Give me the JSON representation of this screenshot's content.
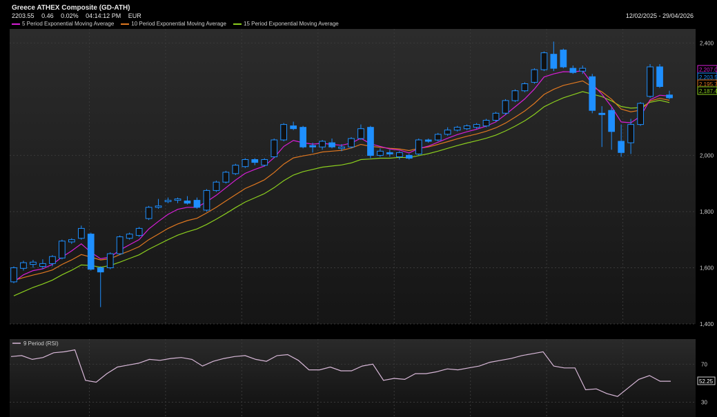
{
  "header": {
    "title": "Greece ATHEX Composite (GD-ATH)",
    "last": "2203.55",
    "change": "0.46",
    "change_pct": "0.02%",
    "time": "04:14:12 PM",
    "currency": "EUR",
    "date_range": "12/02/2025 - 29/04/2026"
  },
  "colors": {
    "background": "#000000",
    "panel_top": "#2a2a2a",
    "panel_bottom": "#141414",
    "grid": "#3a3a3a",
    "candle": "#1e8fff",
    "ema5": "#d81ed8",
    "ema10": "#e07820",
    "ema15": "#8ccf1e",
    "rsi": "#d8b8d8"
  },
  "chart_data": [
    {
      "type": "candlestick",
      "title": "Greece ATHEX Composite (GD-ATH)",
      "ylim": [
        1400,
        2450
      ],
      "y_ticks": [
        "1,400",
        "1,600",
        "1,800",
        "2,000",
        "2,400"
      ],
      "y_tick_values": [
        1400,
        1600,
        1800,
        2000,
        2400
      ],
      "legend_position": "top-left",
      "grid": true,
      "series": [
        {
          "name": "5 Period Exponential Moving Average",
          "color": "#d81ed8"
        },
        {
          "name": "10 Period Exponential Moving Average",
          "color": "#e07820"
        },
        {
          "name": "15 Period Exponential Moving Average",
          "color": "#8ccf1e"
        }
      ],
      "candles": [
        [
          1550,
          1605,
          1545,
          1600
        ],
        [
          1598,
          1625,
          1590,
          1618
        ],
        [
          1612,
          1628,
          1600,
          1620
        ],
        [
          1605,
          1630,
          1595,
          1615
        ],
        [
          1615,
          1645,
          1605,
          1640
        ],
        [
          1635,
          1700,
          1630,
          1695
        ],
        [
          1692,
          1705,
          1685,
          1700
        ],
        [
          1705,
          1750,
          1700,
          1740
        ],
        [
          1720,
          1725,
          1590,
          1595
        ],
        [
          1600,
          1605,
          1460,
          1585
        ],
        [
          1600,
          1655,
          1595,
          1650
        ],
        [
          1650,
          1715,
          1645,
          1710
        ],
        [
          1705,
          1725,
          1700,
          1720
        ],
        [
          1715,
          1745,
          1710,
          1740
        ],
        [
          1775,
          1820,
          1770,
          1815
        ],
        [
          1815,
          1845,
          1810,
          1820
        ],
        [
          1835,
          1850,
          1830,
          1840
        ],
        [
          1840,
          1850,
          1830,
          1845
        ],
        [
          1838,
          1855,
          1825,
          1830
        ],
        [
          1840,
          1850,
          1810,
          1815
        ],
        [
          1805,
          1880,
          1800,
          1875
        ],
        [
          1875,
          1910,
          1870,
          1905
        ],
        [
          1905,
          1945,
          1900,
          1940
        ],
        [
          1935,
          1970,
          1930,
          1965
        ],
        [
          1960,
          1990,
          1955,
          1985
        ],
        [
          1985,
          1990,
          1965,
          1975
        ],
        [
          1965,
          1990,
          1960,
          1985
        ],
        [
          1995,
          2060,
          1990,
          2055
        ],
        [
          2055,
          2115,
          2050,
          2110
        ],
        [
          2105,
          2120,
          2090,
          2095
        ],
        [
          2100,
          2105,
          2025,
          2030
        ],
        [
          2035,
          2045,
          2010,
          2030
        ],
        [
          2030,
          2055,
          2020,
          2050
        ],
        [
          2045,
          2060,
          2025,
          2030
        ],
        [
          2025,
          2040,
          2015,
          2030
        ],
        [
          2030,
          2065,
          2025,
          2060
        ],
        [
          2060,
          2110,
          2055,
          2095
        ],
        [
          2100,
          2105,
          1990,
          2000
        ],
        [
          2000,
          2025,
          1995,
          2015
        ],
        [
          2010,
          2020,
          1995,
          2005
        ],
        [
          1995,
          2015,
          1985,
          2010
        ],
        [
          2000,
          2005,
          1985,
          1990
        ],
        [
          2005,
          2060,
          2000,
          2055
        ],
        [
          2055,
          2060,
          2045,
          2050
        ],
        [
          2055,
          2080,
          2050,
          2075
        ],
        [
          2075,
          2100,
          2070,
          2090
        ],
        [
          2090,
          2105,
          2085,
          2100
        ],
        [
          2095,
          2110,
          2090,
          2105
        ],
        [
          2100,
          2115,
          2095,
          2110
        ],
        [
          2105,
          2130,
          2100,
          2125
        ],
        [
          2125,
          2155,
          2120,
          2150
        ],
        [
          2150,
          2200,
          2145,
          2195
        ],
        [
          2195,
          2235,
          2190,
          2230
        ],
        [
          2230,
          2260,
          2225,
          2255
        ],
        [
          2260,
          2310,
          2255,
          2305
        ],
        [
          2305,
          2370,
          2300,
          2365
        ],
        [
          2360,
          2405,
          2300,
          2310
        ],
        [
          2375,
          2380,
          2310,
          2315
        ],
        [
          2310,
          2320,
          2290,
          2295
        ],
        [
          2300,
          2320,
          2290,
          2310
        ],
        [
          2280,
          2290,
          2150,
          2160
        ],
        [
          2150,
          2175,
          2030,
          2145
        ],
        [
          2160,
          2170,
          2020,
          2085
        ],
        [
          2050,
          2110,
          1995,
          2010
        ],
        [
          2045,
          2130,
          2005,
          2110
        ],
        [
          2110,
          2190,
          2105,
          2185
        ],
        [
          2210,
          2325,
          2205,
          2315
        ],
        [
          2315,
          2325,
          2240,
          2245
        ],
        [
          2215,
          2230,
          2200,
          2205
        ]
      ],
      "ema5": [
        1550,
        1575,
        1590,
        1596,
        1612,
        1638,
        1660,
        1685,
        1655,
        1632,
        1638,
        1663,
        1682,
        1700,
        1738,
        1765,
        1790,
        1808,
        1815,
        1815,
        1835,
        1858,
        1885,
        1912,
        1936,
        1950,
        1962,
        1992,
        2032,
        2053,
        2045,
        2040,
        2043,
        2039,
        2036,
        2044,
        2061,
        2041,
        2032,
        2023,
        2019,
        2009,
        2024,
        2033,
        2047,
        2061,
        2074,
        2084,
        2093,
        2104,
        2119,
        2145,
        2173,
        2201,
        2236,
        2279,
        2290,
        2298,
        2297,
        2301,
        2254,
        2218,
        2173,
        2119,
        2116,
        2139,
        2198,
        2214,
        2211
      ],
      "ema10": [
        1555,
        1565,
        1574,
        1582,
        1592,
        1612,
        1628,
        1647,
        1638,
        1628,
        1632,
        1647,
        1660,
        1675,
        1700,
        1720,
        1740,
        1756,
        1768,
        1776,
        1795,
        1815,
        1838,
        1860,
        1882,
        1897,
        1913,
        1939,
        1969,
        1991,
        1998,
        2004,
        2012,
        2015,
        2018,
        2026,
        2039,
        2032,
        2029,
        2025,
        2023,
        2017,
        2025,
        2030,
        2039,
        2049,
        2059,
        2068,
        2076,
        2086,
        2098,
        2115,
        2136,
        2158,
        2185,
        2217,
        2235,
        2249,
        2257,
        2265,
        2244,
        2226,
        2200,
        2165,
        2155,
        2161,
        2194,
        2203,
        2196
      ],
      "ema15": [
        1500,
        1515,
        1530,
        1542,
        1556,
        1575,
        1591,
        1610,
        1608,
        1602,
        1608,
        1620,
        1633,
        1646,
        1666,
        1683,
        1700,
        1716,
        1728,
        1738,
        1754,
        1773,
        1793,
        1814,
        1834,
        1849,
        1864,
        1885,
        1910,
        1930,
        1942,
        1950,
        1958,
        1962,
        1966,
        1973,
        1985,
        1987,
        1990,
        1990,
        1993,
        1992,
        1999,
        2006,
        2015,
        2025,
        2035,
        2044,
        2052,
        2061,
        2072,
        2087,
        2104,
        2123,
        2146,
        2173,
        2190,
        2205,
        2216,
        2227,
        2218,
        2209,
        2194,
        2174,
        2168,
        2170,
        2189,
        2196,
        2188
      ]
    },
    {
      "type": "line",
      "title": "9 Period (RSI)",
      "ylim": [
        18,
        92
      ],
      "y_ticks": [
        "70",
        "30"
      ],
      "y_tick_values": [
        70,
        30
      ],
      "last_value": "52.25",
      "series": [
        {
          "name": "9 Period (RSI)",
          "color": "#d8b8d8",
          "values": [
            78,
            79,
            75,
            77,
            82,
            83,
            85,
            53,
            51,
            60,
            67,
            69,
            71,
            75,
            74,
            76,
            77,
            75,
            68,
            73,
            76,
            78,
            79,
            75,
            73,
            79,
            80,
            74,
            64,
            64,
            67,
            63,
            63,
            68,
            70,
            53,
            55,
            54,
            60,
            60,
            62,
            65,
            64,
            66,
            68,
            72,
            74,
            76,
            79,
            81,
            83,
            68,
            66,
            66,
            43,
            44,
            39,
            36,
            45,
            54,
            58,
            52,
            52
          ]
        }
      ]
    }
  ],
  "badges": {
    "ema5_value": "2,207.0",
    "last_value": "2,203.5",
    "ema10_value": "2,195.7",
    "ema15_value": "2,187.4"
  }
}
